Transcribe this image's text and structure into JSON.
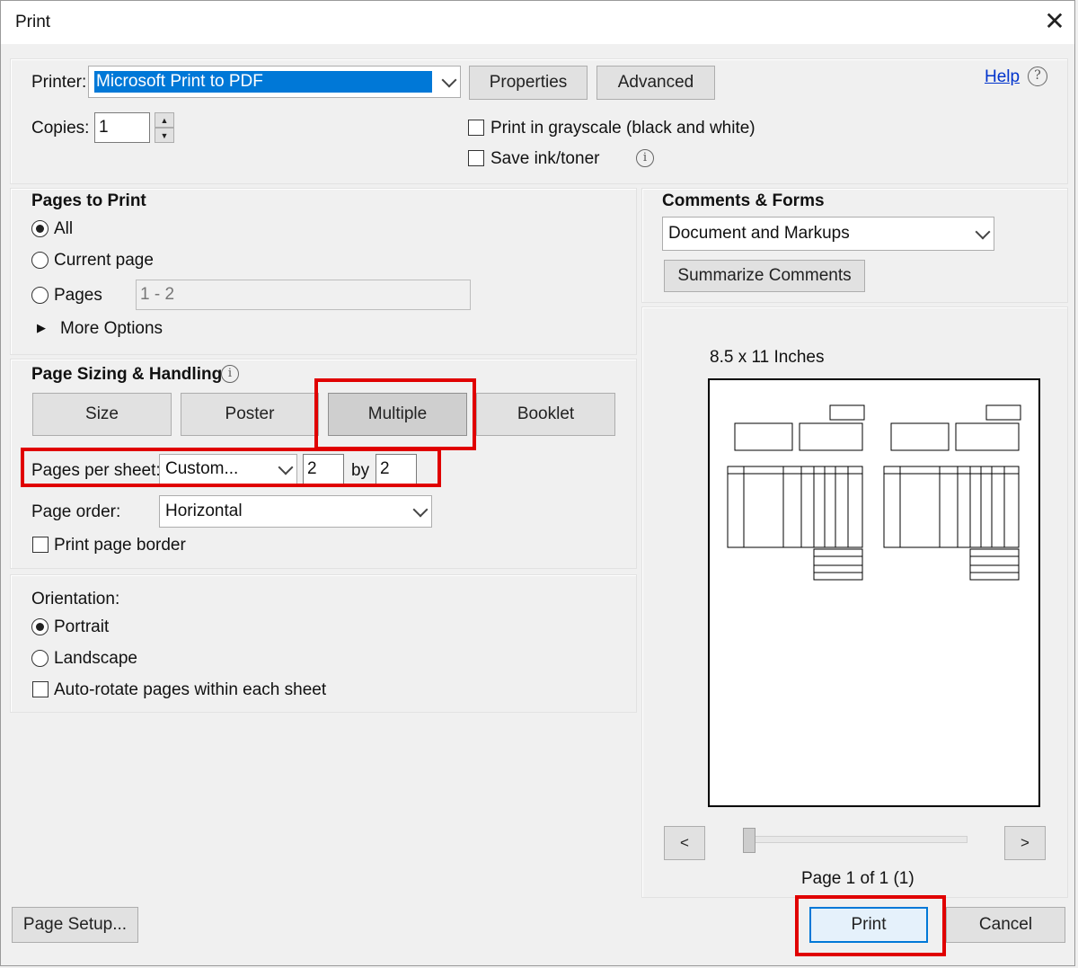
{
  "window": {
    "title": "Print",
    "close_glyph": "✕"
  },
  "printer": {
    "label": "Printer:",
    "value": "Microsoft Print to PDF",
    "properties_label": "Properties",
    "advanced_label": "Advanced",
    "help_label": "Help",
    "copies_label": "Copies:",
    "copies_value": "1",
    "grayscale_label": "Print in grayscale (black and white)",
    "save_ink_label": "Save ink/toner"
  },
  "pages_to_print": {
    "title": "Pages to Print",
    "all_label": "All",
    "current_label": "Current page",
    "pages_label": "Pages",
    "pages_value": "1 - 2",
    "more_options_label": "More Options",
    "selected": "All"
  },
  "page_sizing": {
    "title": "Page Sizing & Handling",
    "tabs": [
      "Size",
      "Poster",
      "Multiple",
      "Booklet"
    ],
    "active_tab": "Multiple",
    "pages_per_sheet_label": "Pages per sheet:",
    "pages_per_sheet_value": "Custom...",
    "cols": "2",
    "by_label": "by",
    "rows": "2",
    "page_order_label": "Page order:",
    "page_order_value": "Horizontal",
    "border_label": "Print page border"
  },
  "orientation": {
    "title": "Orientation:",
    "portrait_label": "Portrait",
    "landscape_label": "Landscape",
    "auto_rotate_label": "Auto-rotate pages within each sheet",
    "selected": "Portrait"
  },
  "comments": {
    "title": "Comments & Forms",
    "value": "Document and Markups",
    "summarize_label": "Summarize Comments"
  },
  "preview": {
    "size_label": "8.5 x 11 Inches",
    "prev_label": "<",
    "next_label": ">",
    "page_status": "Page 1 of 1 (1)"
  },
  "footer": {
    "page_setup_label": "Page Setup...",
    "print_label": "Print",
    "cancel_label": "Cancel"
  },
  "highlight_color": "#e00000"
}
